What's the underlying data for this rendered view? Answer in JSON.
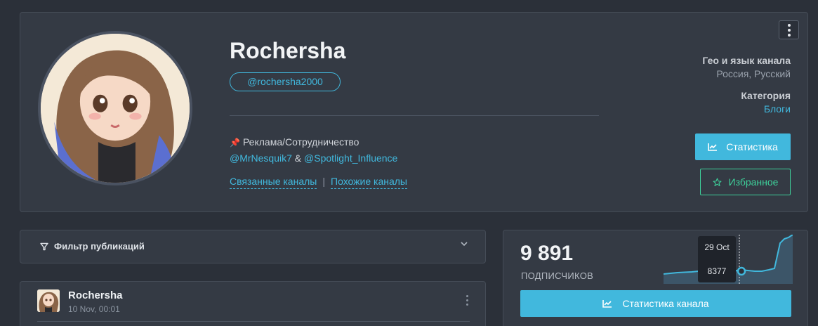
{
  "profile": {
    "name": "Rochersha",
    "handle": "@rochersha2000",
    "description_line1": "Реклама/Сотрудничество",
    "link1": "@MrNesquik7",
    "amp": " & ",
    "link2": "@Spotlight_Influence",
    "related_label": "Связанные каналы",
    "similar_label": "Похожие каналы",
    "divider": "|",
    "geo_label": "Гео и язык канала",
    "geo_value": "Россия, Русский",
    "category_label": "Категория",
    "category_value": "Блоги",
    "stats_button": "Статистика",
    "favorite_button": "Избранное"
  },
  "filter": {
    "label": "Фильтр публикаций"
  },
  "post": {
    "author": "Rochersha",
    "date": "10 Nov, 00:01"
  },
  "stats": {
    "subscribers": "9 891",
    "subscribers_label": "ПОДПИСЧИКОВ",
    "tooltip_date": "29 Oct",
    "tooltip_value": "8377",
    "channel_stats_button": "Статистика канала"
  },
  "colors": {
    "accent": "#41b8dd",
    "favorite": "#3ecf9a",
    "background": "#2b3039",
    "card": "#343a44"
  },
  "icons": [
    "menu-dots-icon",
    "chart-icon",
    "star-icon",
    "filter-icon",
    "chevron-down-icon",
    "pin-icon"
  ]
}
